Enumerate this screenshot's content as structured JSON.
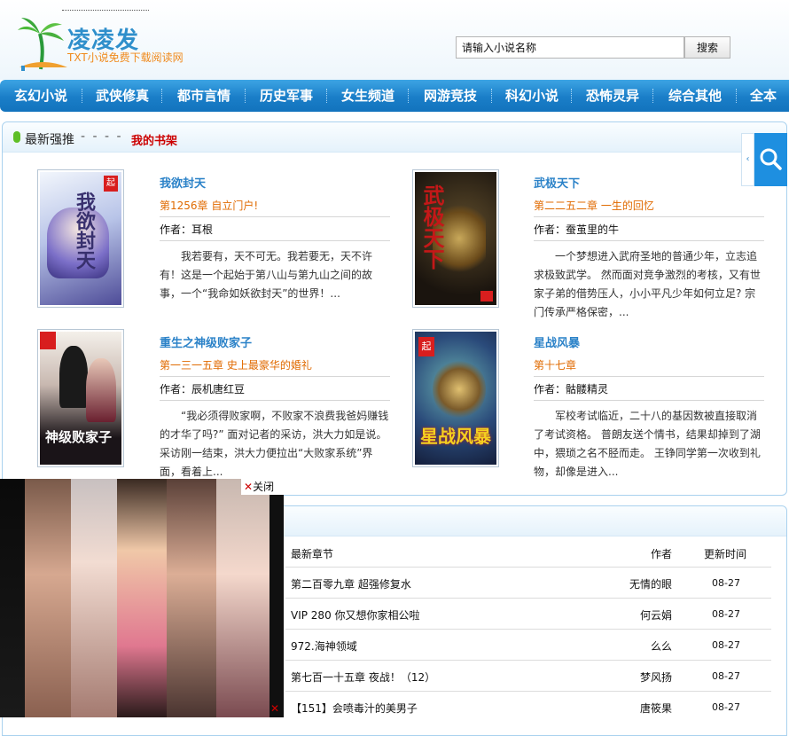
{
  "site": {
    "name": "凌凌发",
    "tagline": "TXT小说免费下载阅读网"
  },
  "search": {
    "value": "请输入小说名称",
    "button": "搜索"
  },
  "nav": [
    "玄幻小说",
    "武侠修真",
    "都市言情",
    "历史军事",
    "女生频道",
    "网游竞技",
    "科幻小说",
    "恐怖灵异",
    "综合其他",
    "全本"
  ],
  "recommend": {
    "tab_latest": "最新强推",
    "tab_sep": "- - - -",
    "tab_shelf": "我的书架",
    "books": [
      {
        "title": "我欲封天",
        "chapter": "第1256章 自立门户!",
        "author": "作者：耳根",
        "desc": "我若要有，天不可无。我若要无，天不许有！这是一个起始于第八山与第九山之间的故事，一个“我命如妖欲封天”的世界！...",
        "cover_text": "我欲封天",
        "cover_colors": [
          "#e8f0fb",
          "#5b5fa8"
        ]
      },
      {
        "title": "武极天下",
        "chapter": "第二二五二章 一生的回忆",
        "author": "作者：蚕茧里的牛",
        "desc": "一个梦想进入武府圣地的普通少年，立志追求极致武学。 然而面对竞争激烈的考核，又有世家子弟的借势压人，小小平凡少年如何立足? 宗门传承严格保密，...",
        "cover_text": "武极天下",
        "cover_colors": [
          "#201a12",
          "#b01818"
        ]
      },
      {
        "title": "重生之神级败家子",
        "chapter": "第一三一五章 史上最豪华的婚礼",
        "author": "作者：辰机唐红豆",
        "desc": "“我必须得败家啊，不败家不浪费我爸妈赚钱的才华了吗?” 面对记者的采访，洪大力如是说。 采访刚一结束，洪大力便拉出“大败家系统”界面，看着上...",
        "cover_text": "神级败家子",
        "cover_colors": [
          "#1a1418",
          "#7a2530"
        ]
      },
      {
        "title": "星战风暴",
        "chapter": "第十七章",
        "author": "作者：骷髅精灵",
        "desc": "军校考试临近，二十八的基因数被直接取消了考试资格。 普朗友送个情书，结果却掉到了湖中，猥琐之名不胫而走。 王铮同学第一次收到礼物，却像是进入...",
        "cover_text": "星战风暴",
        "cover_colors": [
          "#1d3a6b",
          "#3a8a7a"
        ]
      }
    ]
  },
  "latest": {
    "headers": {
      "chapter": "最新章节",
      "author": "作者",
      "time": "更新时间"
    },
    "rows": [
      {
        "chapter": "第二百零九章 超强修复水",
        "author": "无情的眼",
        "time": "08-27"
      },
      {
        "chapter": "VIP 280 你又想你家相公啦",
        "author": "何云娟",
        "time": "08-27"
      },
      {
        "chapter": "972.海神领域",
        "author": "么么",
        "time": "08-27"
      },
      {
        "chapter": "第七百一十五章 夜战！（12）",
        "author": "梦风扬",
        "time": "08-27"
      },
      {
        "chapter": "【151】会喷毒汁的美男子",
        "author": "唐筱果",
        "time": "08-27"
      }
    ]
  },
  "ad": {
    "close_label": "关闭",
    "close_mark": "✕"
  },
  "colors": {
    "nav": "#1a7ec8",
    "link": "#2b82c8",
    "chapter": "#e06a00",
    "shelf": "#cc0000"
  }
}
